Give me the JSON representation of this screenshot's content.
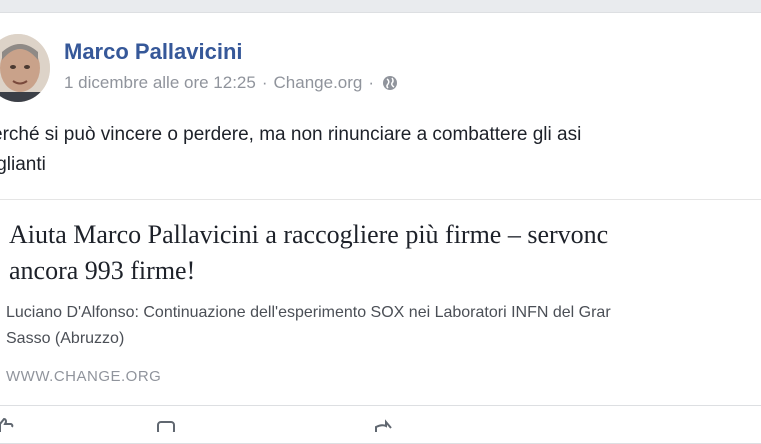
{
  "post": {
    "author": "Marco Pallavicini",
    "date": "1 dicembre alle ore 12:25",
    "separator": "·",
    "source": "Change.org",
    "audience_icon": "globe-icon",
    "text": "erché si può vincere o perdere, ma non rinunciare a combattere gli asi",
    "text_line2": "iglianti"
  },
  "link": {
    "title_line1": "Aiuta Marco Pallavicini a raccogliere più firme – servonc",
    "title_line2": "ancora 993 firme!",
    "description_line1": "Luciano D'Alfonso: Continuazione dell'esperimento SOX nei Laboratori INFN del Grar",
    "description_line2": "Sasso (Abruzzo)",
    "domain": "WWW.CHANGE.ORG"
  },
  "actions": {
    "icons": [
      "like-icon",
      "comment-icon",
      "share-icon"
    ]
  },
  "colors": {
    "author_link": "#365899",
    "meta_gray": "#90949c",
    "text": "#1d2129",
    "background": "#e9ebee"
  }
}
